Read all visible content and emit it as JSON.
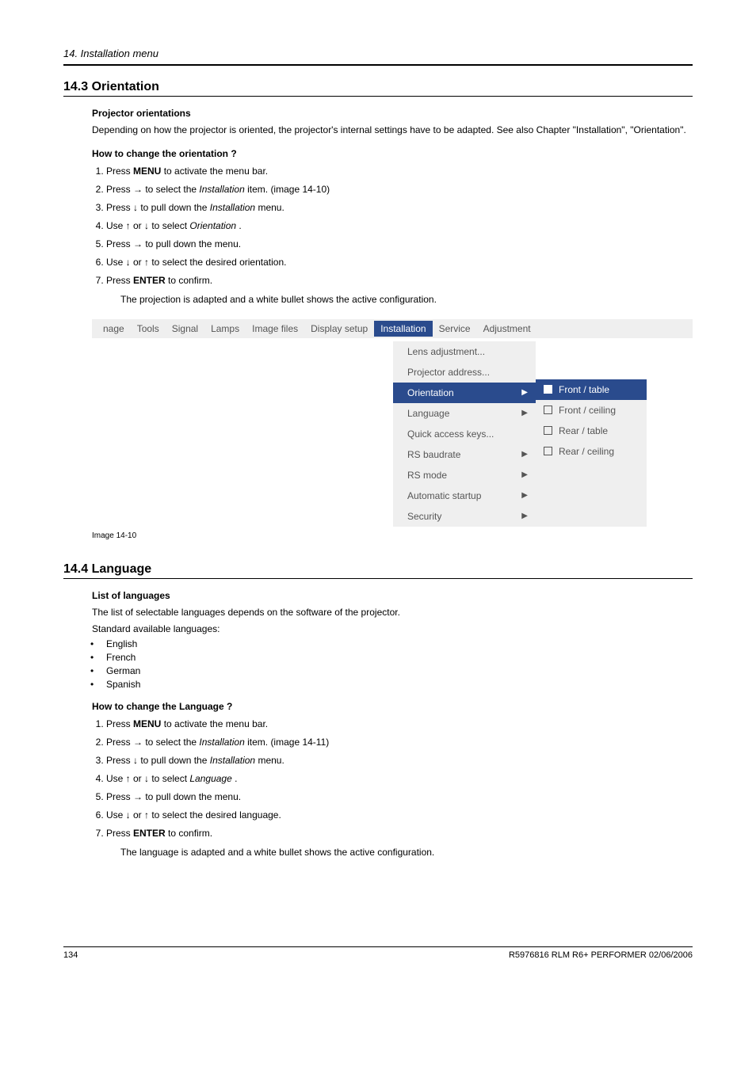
{
  "header": {
    "chapter": "14. Installation menu"
  },
  "section143": {
    "title": "14.3  Orientation",
    "sub1": "Projector orientations",
    "para1": "Depending on how the projector is oriented, the projector's internal settings have to be adapted.  See also Chapter \"Installation\", \"Orientation\".",
    "sub2": "How to change the orientation ?",
    "steps": {
      "s1a": "Press ",
      "s1b": "MENU",
      "s1c": " to activate the menu bar.",
      "s2a": "Press → to select the ",
      "s2b": "Installation",
      "s2c": " item.  (image 14-10)",
      "s3a": "Press ↓ to pull down the ",
      "s3b": "Installation",
      "s3c": " menu.",
      "s4a": "Use ↑ or ↓ to select ",
      "s4b": "Orientation",
      "s4c": " .",
      "s5": "Press → to pull down the menu.",
      "s6": "Use ↓ or ↑ to select the desired orientation.",
      "s7a": "Press ",
      "s7b": "ENTER",
      "s7c": " to confirm.",
      "result": "The projection is adapted and a white bullet shows the active configuration."
    },
    "caption": "Image 14-10"
  },
  "menubar": {
    "items": [
      "nage",
      "Tools",
      "Signal",
      "Lamps",
      "Image files",
      "Display setup",
      "Installation",
      "Service",
      "Adjustment"
    ],
    "active_index": 6
  },
  "dropdown": {
    "items": [
      {
        "label": "Lens adjustment...",
        "arrow": false
      },
      {
        "label": "Projector address...",
        "arrow": false
      },
      {
        "label": "Orientation",
        "arrow": true,
        "active": true
      },
      {
        "label": "Language",
        "arrow": true
      },
      {
        "label": "Quick access keys...",
        "arrow": false
      },
      {
        "label": "RS baudrate",
        "arrow": true
      },
      {
        "label": "RS mode",
        "arrow": true
      },
      {
        "label": "Automatic startup",
        "arrow": true
      },
      {
        "label": "Security",
        "arrow": true
      }
    ]
  },
  "submenu": {
    "items": [
      {
        "label": "Front / table",
        "filled": true,
        "active": true
      },
      {
        "label": "Front / ceiling",
        "filled": false
      },
      {
        "label": "Rear / table",
        "filled": false
      },
      {
        "label": "Rear / ceiling",
        "filled": false
      }
    ]
  },
  "section144": {
    "title": "14.4  Language",
    "sub1": "List of languages",
    "para1": "The list of selectable languages depends on the software of the projector.",
    "para2": "Standard available languages:",
    "langs": [
      "English",
      "French",
      "German",
      "Spanish"
    ],
    "sub2": "How to change the Language ?",
    "steps": {
      "s1a": "Press ",
      "s1b": "MENU",
      "s1c": " to activate the menu bar.",
      "s2a": "Press → to select the ",
      "s2b": "Installation",
      "s2c": " item.  (image 14-11)",
      "s3a": "Press ↓ to pull down the ",
      "s3b": "Installation",
      "s3c": " menu.",
      "s4a": "Use ↑ or ↓ to select ",
      "s4b": "Language",
      "s4c": " .",
      "s5": "Press → to pull down the menu.",
      "s6": "Use ↓ or ↑ to select the desired language.",
      "s7a": "Press ",
      "s7b": "ENTER",
      "s7c": " to confirm.",
      "result": "The language is adapted and a white bullet shows the active configuration."
    }
  },
  "footer": {
    "page": "134",
    "doc": "R5976816  RLM R6+ PERFORMER  02/06/2006"
  }
}
